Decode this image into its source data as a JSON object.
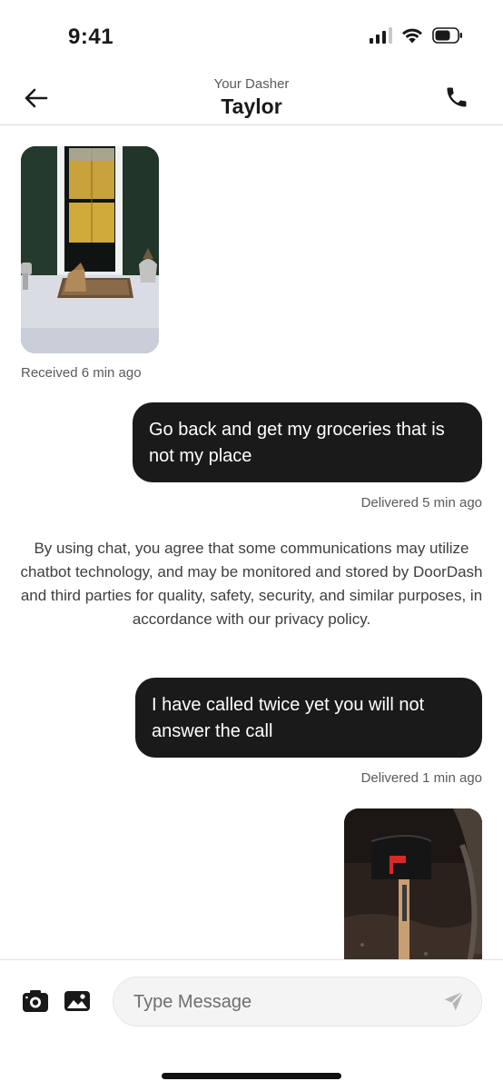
{
  "status_bar": {
    "time": "9:41",
    "icons": [
      "cellular-signal-icon",
      "wifi-icon",
      "battery-icon"
    ]
  },
  "header": {
    "subtitle": "Your Dasher",
    "title": "Taylor",
    "icons": {
      "back": "arrow-left-icon",
      "call": "phone-icon"
    }
  },
  "messages": [
    {
      "type": "image",
      "from": "dasher",
      "description": "photo of front door with grocery bag on doormat",
      "meta": "Received 6 min ago"
    },
    {
      "type": "text",
      "from": "me",
      "text": "Go back and get my groceries that is not my place",
      "meta": "Delivered 5 min ago"
    },
    {
      "type": "system",
      "text": "By using chat, you agree that some communications may utilize chatbot technology, and may be monitored and stored by DoorDash and third parties for quality, safety, security, and similar purposes, in accordance with our privacy policy."
    },
    {
      "type": "text",
      "from": "me",
      "text": "I have called twice yet you will not answer the call",
      "meta": "Delivered 1 min ago"
    },
    {
      "type": "image",
      "from": "me",
      "description": "photo of black mailbox on wooden post at night"
    }
  ],
  "composer": {
    "placeholder": "Type Message",
    "value": "",
    "icons": {
      "camera": "camera-icon",
      "gallery": "gallery-icon",
      "send": "send-icon"
    }
  },
  "colors": {
    "bubble": "#1a1a1a",
    "bubble_text": "#ffffff",
    "muted_text": "#5a5a5a",
    "divider": "#dcdcdc"
  }
}
